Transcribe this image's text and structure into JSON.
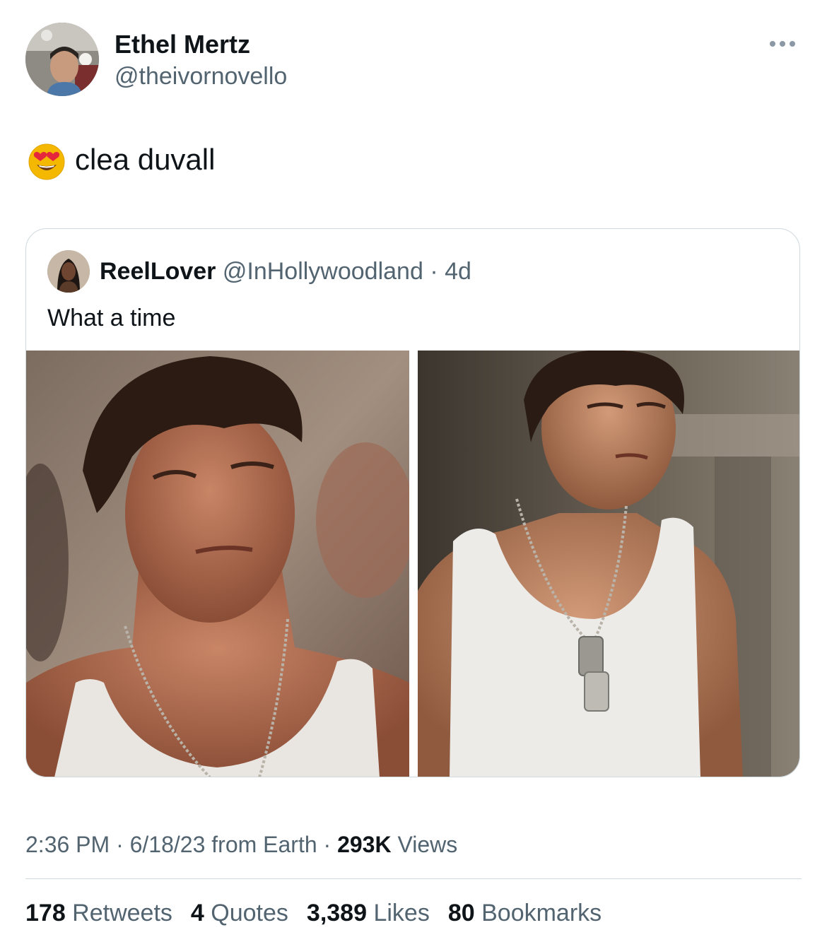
{
  "author": {
    "display_name": "Ethel Mertz",
    "handle": "@theivornovello",
    "avatar_icon": "user-avatar-photo"
  },
  "more_icon": "more-horizontal-icon",
  "tweet": {
    "emoji": "smiling-face-with-heart-eyes-emoji",
    "text": "clea duvall"
  },
  "quoted_tweet": {
    "display_name": "ReelLover",
    "handle": "@InHollywoodland",
    "separator": "·",
    "age": "4d",
    "text": "What a time",
    "photos": [
      "photo-1",
      "photo-2"
    ]
  },
  "meta": {
    "time": "2:36 PM",
    "sep1": " · ",
    "date_source": "6/18/23 from Earth",
    "sep2": " · ",
    "views_count": "293K",
    "views_label": " Views"
  },
  "stats": {
    "retweets_count": "178",
    "retweets_label": " Retweets",
    "quotes_count": "4",
    "quotes_label": " Quotes",
    "likes_count": "3,389",
    "likes_label": " Likes",
    "bookmarks_count": "80",
    "bookmarks_label": " Bookmarks"
  },
  "colors": {
    "text_primary": "#0f1419",
    "text_secondary": "#536471",
    "border": "#cfd9de"
  }
}
